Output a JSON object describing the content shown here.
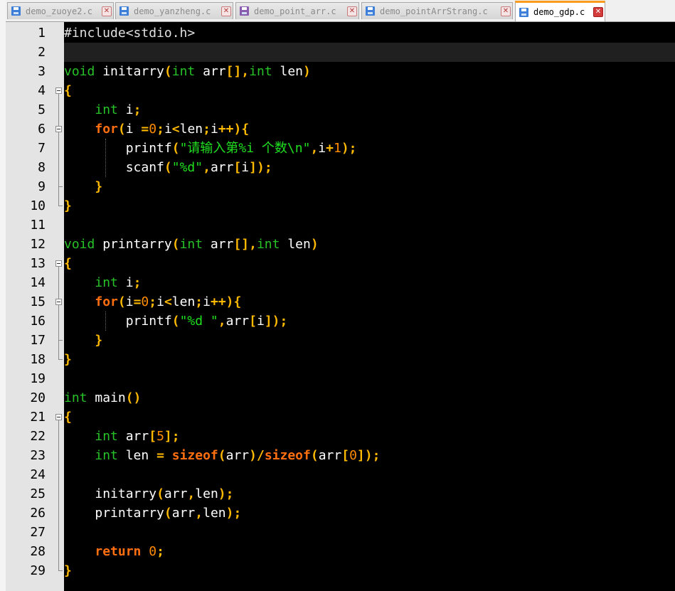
{
  "tabs": [
    {
      "label": "demo_zuoye2.c",
      "icon": "file-saved-icon",
      "active": false
    },
    {
      "label": "demo_yanzheng.c",
      "icon": "file-saved-icon",
      "active": false
    },
    {
      "label": "demo_point_arr.c",
      "icon": "file-modified-icon",
      "active": false
    },
    {
      "label": "demo_pointArrStrang.c",
      "icon": "file-saved-icon",
      "active": false
    },
    {
      "label": "demo_gdp.c",
      "icon": "file-saved-icon",
      "active": true
    }
  ],
  "tab_close_glyph": "✕",
  "current_line": 2,
  "colors": {
    "keyword": "#27c227",
    "control": "#ff6f10",
    "operator": "#ffba00",
    "number": "#ff8c00",
    "string": "#1fe01f",
    "editor_bg": "#000000",
    "gutter_bg": "#e4e4e4",
    "active_tab_accent": "#fa9c1c"
  },
  "code": {
    "lines": [
      {
        "n": "1",
        "tokens": [
          {
            "t": "#include<stdio.h>",
            "k": "pre"
          }
        ]
      },
      {
        "n": "2",
        "tokens": []
      },
      {
        "n": "3",
        "tokens": [
          {
            "t": "void",
            "k": "kw"
          },
          {
            "t": " initarry",
            "k": "id"
          },
          {
            "t": "(",
            "k": "op"
          },
          {
            "t": "int",
            "k": "kw"
          },
          {
            "t": " arr",
            "k": "id"
          },
          {
            "t": "[],",
            "k": "op"
          },
          {
            "t": "int",
            "k": "kw"
          },
          {
            "t": " len",
            "k": "id"
          },
          {
            "t": ")",
            "k": "op"
          }
        ]
      },
      {
        "n": "4",
        "tokens": [
          {
            "t": "{",
            "k": "op"
          }
        ]
      },
      {
        "n": "5",
        "tokens": [
          {
            "t": "    ",
            "k": "id"
          },
          {
            "t": "int",
            "k": "kw"
          },
          {
            "t": " i",
            "k": "id"
          },
          {
            "t": ";",
            "k": "op"
          }
        ]
      },
      {
        "n": "6",
        "tokens": [
          {
            "t": "    ",
            "k": "id"
          },
          {
            "t": "for",
            "k": "ctrl"
          },
          {
            "t": "(",
            "k": "op"
          },
          {
            "t": "i ",
            "k": "id"
          },
          {
            "t": "=",
            "k": "op"
          },
          {
            "t": "0",
            "k": "num"
          },
          {
            "t": ";",
            "k": "op"
          },
          {
            "t": "i",
            "k": "id"
          },
          {
            "t": "<",
            "k": "op"
          },
          {
            "t": "len",
            "k": "id"
          },
          {
            "t": ";",
            "k": "op"
          },
          {
            "t": "i",
            "k": "id"
          },
          {
            "t": "++){",
            "k": "op"
          }
        ]
      },
      {
        "n": "7",
        "tokens": [
          {
            "t": "        ",
            "k": "id"
          },
          {
            "t": "printf",
            "k": "id"
          },
          {
            "t": "(",
            "k": "op"
          },
          {
            "t": "\"请输入第%i 个数\\n\"",
            "k": "str"
          },
          {
            "t": ",",
            "k": "op"
          },
          {
            "t": "i",
            "k": "id"
          },
          {
            "t": "+",
            "k": "op"
          },
          {
            "t": "1",
            "k": "num"
          },
          {
            "t": ");",
            "k": "op"
          }
        ]
      },
      {
        "n": "8",
        "tokens": [
          {
            "t": "        ",
            "k": "id"
          },
          {
            "t": "scanf",
            "k": "id"
          },
          {
            "t": "(",
            "k": "op"
          },
          {
            "t": "\"%d\"",
            "k": "str"
          },
          {
            "t": ",",
            "k": "op"
          },
          {
            "t": "arr",
            "k": "id"
          },
          {
            "t": "[",
            "k": "op"
          },
          {
            "t": "i",
            "k": "id"
          },
          {
            "t": "]);",
            "k": "op"
          }
        ]
      },
      {
        "n": "9",
        "tokens": [
          {
            "t": "    ",
            "k": "id"
          },
          {
            "t": "}",
            "k": "op"
          }
        ]
      },
      {
        "n": "10",
        "tokens": [
          {
            "t": "}",
            "k": "op"
          }
        ]
      },
      {
        "n": "11",
        "tokens": []
      },
      {
        "n": "12",
        "tokens": [
          {
            "t": "void",
            "k": "kw"
          },
          {
            "t": " printarry",
            "k": "id"
          },
          {
            "t": "(",
            "k": "op"
          },
          {
            "t": "int",
            "k": "kw"
          },
          {
            "t": " arr",
            "k": "id"
          },
          {
            "t": "[],",
            "k": "op"
          },
          {
            "t": "int",
            "k": "kw"
          },
          {
            "t": " len",
            "k": "id"
          },
          {
            "t": ")",
            "k": "op"
          }
        ]
      },
      {
        "n": "13",
        "tokens": [
          {
            "t": "{",
            "k": "op"
          }
        ]
      },
      {
        "n": "14",
        "tokens": [
          {
            "t": "    ",
            "k": "id"
          },
          {
            "t": "int",
            "k": "kw"
          },
          {
            "t": " i",
            "k": "id"
          },
          {
            "t": ";",
            "k": "op"
          }
        ]
      },
      {
        "n": "15",
        "tokens": [
          {
            "t": "    ",
            "k": "id"
          },
          {
            "t": "for",
            "k": "ctrl"
          },
          {
            "t": "(",
            "k": "op"
          },
          {
            "t": "i",
            "k": "id"
          },
          {
            "t": "=",
            "k": "op"
          },
          {
            "t": "0",
            "k": "num"
          },
          {
            "t": ";",
            "k": "op"
          },
          {
            "t": "i",
            "k": "id"
          },
          {
            "t": "<",
            "k": "op"
          },
          {
            "t": "len",
            "k": "id"
          },
          {
            "t": ";",
            "k": "op"
          },
          {
            "t": "i",
            "k": "id"
          },
          {
            "t": "++){",
            "k": "op"
          }
        ]
      },
      {
        "n": "16",
        "tokens": [
          {
            "t": "        ",
            "k": "id"
          },
          {
            "t": "printf",
            "k": "id"
          },
          {
            "t": "(",
            "k": "op"
          },
          {
            "t": "\"%d \"",
            "k": "str"
          },
          {
            "t": ",",
            "k": "op"
          },
          {
            "t": "arr",
            "k": "id"
          },
          {
            "t": "[",
            "k": "op"
          },
          {
            "t": "i",
            "k": "id"
          },
          {
            "t": "]);",
            "k": "op"
          }
        ]
      },
      {
        "n": "17",
        "tokens": [
          {
            "t": "    ",
            "k": "id"
          },
          {
            "t": "}",
            "k": "op"
          }
        ]
      },
      {
        "n": "18",
        "tokens": [
          {
            "t": "}",
            "k": "op"
          }
        ]
      },
      {
        "n": "19",
        "tokens": []
      },
      {
        "n": "20",
        "tokens": [
          {
            "t": "int",
            "k": "kw"
          },
          {
            "t": " main",
            "k": "id"
          },
          {
            "t": "()",
            "k": "op"
          }
        ]
      },
      {
        "n": "21",
        "tokens": [
          {
            "t": "{",
            "k": "op"
          }
        ]
      },
      {
        "n": "22",
        "tokens": [
          {
            "t": "    ",
            "k": "id"
          },
          {
            "t": "int",
            "k": "kw"
          },
          {
            "t": " arr",
            "k": "id"
          },
          {
            "t": "[",
            "k": "op"
          },
          {
            "t": "5",
            "k": "num"
          },
          {
            "t": "];",
            "k": "op"
          }
        ]
      },
      {
        "n": "23",
        "tokens": [
          {
            "t": "    ",
            "k": "id"
          },
          {
            "t": "int",
            "k": "kw"
          },
          {
            "t": " len ",
            "k": "id"
          },
          {
            "t": "=",
            "k": "op"
          },
          {
            "t": " ",
            "k": "id"
          },
          {
            "t": "sizeof",
            "k": "ctrl"
          },
          {
            "t": "(",
            "k": "op"
          },
          {
            "t": "arr",
            "k": "id"
          },
          {
            "t": ")/",
            "k": "op"
          },
          {
            "t": "sizeof",
            "k": "ctrl"
          },
          {
            "t": "(",
            "k": "op"
          },
          {
            "t": "arr",
            "k": "id"
          },
          {
            "t": "[",
            "k": "op"
          },
          {
            "t": "0",
            "k": "num"
          },
          {
            "t": "]);",
            "k": "op"
          }
        ]
      },
      {
        "n": "24",
        "tokens": []
      },
      {
        "n": "25",
        "tokens": [
          {
            "t": "    ",
            "k": "id"
          },
          {
            "t": "initarry",
            "k": "id"
          },
          {
            "t": "(",
            "k": "op"
          },
          {
            "t": "arr",
            "k": "id"
          },
          {
            "t": ",",
            "k": "op"
          },
          {
            "t": "len",
            "k": "id"
          },
          {
            "t": ");",
            "k": "op"
          }
        ]
      },
      {
        "n": "26",
        "tokens": [
          {
            "t": "    ",
            "k": "id"
          },
          {
            "t": "printarry",
            "k": "id"
          },
          {
            "t": "(",
            "k": "op"
          },
          {
            "t": "arr",
            "k": "id"
          },
          {
            "t": ",",
            "k": "op"
          },
          {
            "t": "len",
            "k": "id"
          },
          {
            "t": ");",
            "k": "op"
          }
        ]
      },
      {
        "n": "27",
        "tokens": []
      },
      {
        "n": "28",
        "tokens": [
          {
            "t": "    ",
            "k": "id"
          },
          {
            "t": "return",
            "k": "ctrl"
          },
          {
            "t": " ",
            "k": "id"
          },
          {
            "t": "0",
            "k": "num"
          },
          {
            "t": ";",
            "k": "op"
          }
        ]
      },
      {
        "n": "29",
        "tokens": [
          {
            "t": "}",
            "k": "op"
          }
        ]
      }
    ]
  }
}
